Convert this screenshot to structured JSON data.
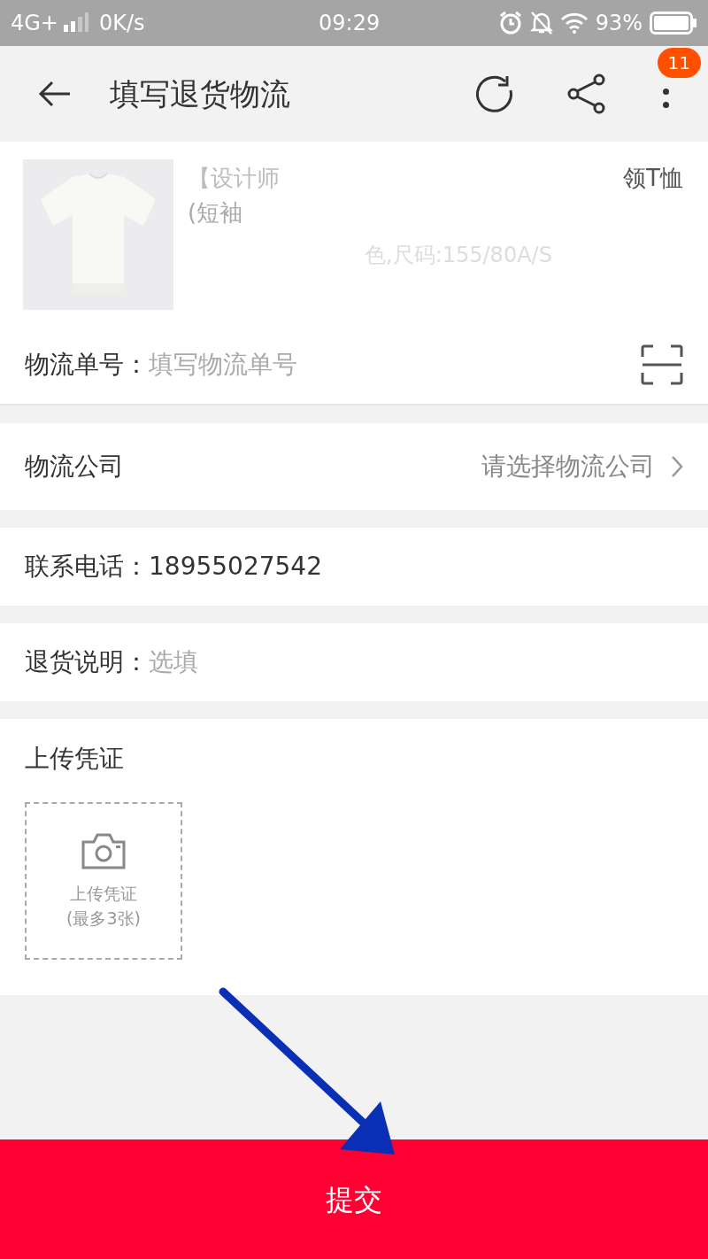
{
  "status_bar": {
    "network": "4G+",
    "speed": "0K/s",
    "time": "09:29",
    "battery": "93%"
  },
  "header": {
    "title": "填写退货物流",
    "badge": "11"
  },
  "product": {
    "title_start": "【设计师",
    "title_end": "领T恤",
    "title_line2": "(短袖",
    "spec": "色,尺码:155/80A/S"
  },
  "form": [
    {
      "kind": "input",
      "label": "物流单号：",
      "placeholder": "填写物流单号"
    },
    {
      "kind": "select",
      "label": "物流公司",
      "placeholder": "请选择物流公司"
    },
    {
      "kind": "value",
      "label": "联系电话：",
      "value": "18955027542"
    },
    {
      "kind": "input",
      "label": "退货说明：",
      "placeholder": "选填"
    }
  ],
  "upload": {
    "title": "上传凭证",
    "box_label": "上传凭证",
    "box_hint": "(最多3张)"
  },
  "submit": "提交"
}
